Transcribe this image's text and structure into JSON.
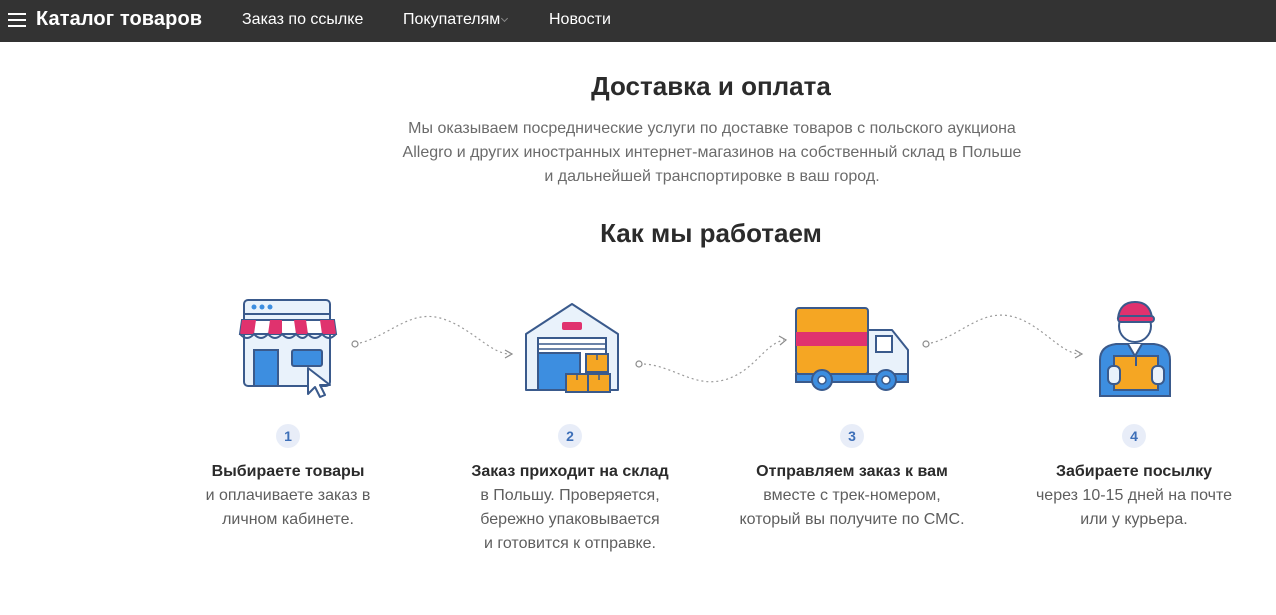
{
  "header": {
    "brand": "Каталог товаров",
    "nav": [
      {
        "label": "Заказ по ссылке"
      },
      {
        "label": "Покупателям"
      },
      {
        "label": "Новости"
      }
    ]
  },
  "main": {
    "title": "Доставка и оплата",
    "intro_lines": [
      "Мы оказываем посреднические услуги по доставке товаров с польского аукциона",
      "Allegro и других иностранных интернет-магазинов на собственный склад в Польше",
      "и дальнейшей транспортировке в ваш город."
    ],
    "how_title": "Как мы работаем",
    "steps": [
      {
        "num": "1",
        "icon": "shop-icon",
        "title": "Выбираете товары",
        "desc_lines": [
          "и оплачиваете заказ в",
          "личном кабинете."
        ]
      },
      {
        "num": "2",
        "icon": "warehouse-icon",
        "title": "Заказ приходит на склад",
        "desc_lines": [
          "в Польшу. Проверяется,",
          "бережно упаковывается",
          "и готовится к отправке."
        ]
      },
      {
        "num": "3",
        "icon": "truck-icon",
        "title": "Отправляем заказ к вам",
        "desc_lines": [
          "вместе с трек-номером,",
          "который вы получите по СМС."
        ]
      },
      {
        "num": "4",
        "icon": "courier-icon",
        "title": "Забираете посылку",
        "desc_lines": [
          "через 10-15 дней на почте",
          "или у курьера."
        ]
      }
    ]
  },
  "colors": {
    "topbar": "#333333",
    "accent_blue": "#3d8ee0",
    "accent_pink": "#e0326e",
    "accent_orange": "#f5a623",
    "outline": "#3a5a8c"
  }
}
